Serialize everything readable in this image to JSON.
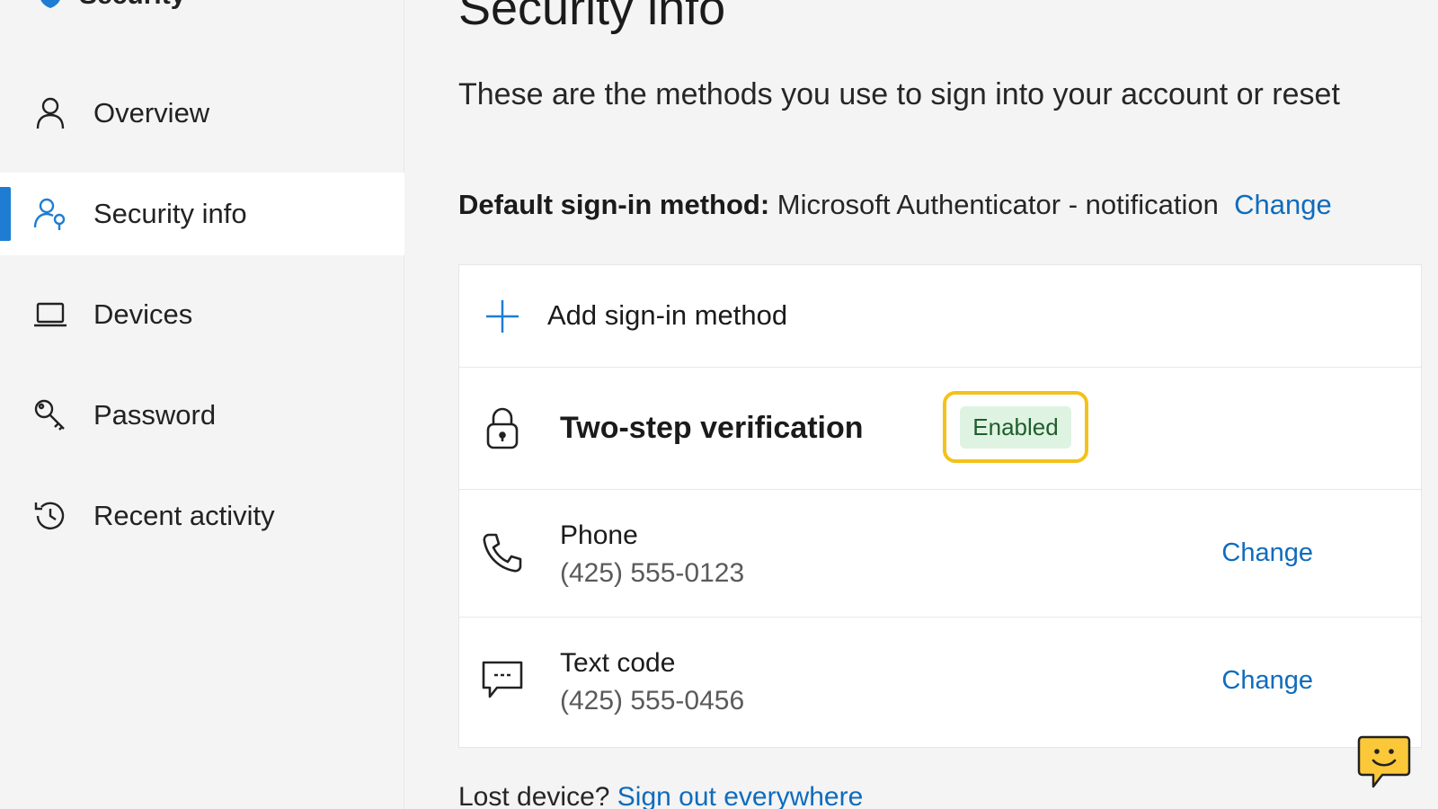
{
  "sidebar": {
    "brand": "Security",
    "items": [
      {
        "label": "Overview",
        "icon": "person-icon"
      },
      {
        "label": "Security info",
        "icon": "person-key-icon",
        "active": true
      },
      {
        "label": "Devices",
        "icon": "laptop-icon"
      },
      {
        "label": "Password",
        "icon": "key-icon"
      },
      {
        "label": "Recent activity",
        "icon": "history-icon"
      }
    ]
  },
  "main": {
    "title": "Security info",
    "description": "These are the methods you use to sign into your account or reset",
    "default_method": {
      "label": "Default sign-in method:",
      "value": "Microsoft Authenticator - notification",
      "change": "Change"
    },
    "add_method": "Add sign-in method",
    "two_step": {
      "label": "Two-step verification",
      "status": "Enabled"
    },
    "methods": [
      {
        "title": "Phone",
        "value": "(425) 555-0123",
        "change": "Change",
        "icon": "phone-icon"
      },
      {
        "title": "Text code",
        "value": "(425) 555-0456",
        "change": "Change",
        "icon": "message-icon"
      }
    ],
    "footer_partial": {
      "text": "Lost device?",
      "link": "Sign out everywhere"
    }
  },
  "colors": {
    "accent": "#0f6cbd",
    "highlight": "#f3c21a",
    "badge_bg": "#dff3e3",
    "badge_text": "#1f5e2c",
    "feedback": "#fbc83a"
  }
}
